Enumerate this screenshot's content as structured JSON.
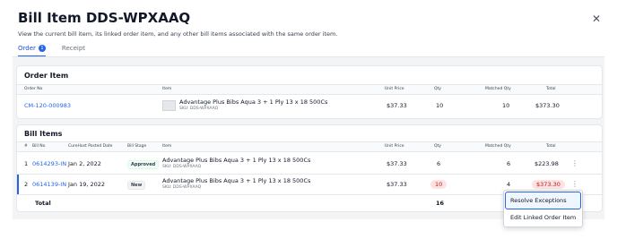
{
  "modal": {
    "title": "Bill Item DDS-WPXAAQ",
    "close_icon": "close-icon",
    "description": "View the current bill item, its linked order item, and any other bill items associated with the same order item."
  },
  "tabs": [
    {
      "label": "Order",
      "count": "1",
      "active": true
    },
    {
      "label": "Receipt",
      "active": false
    }
  ],
  "order_item": {
    "title": "Order Item",
    "columns": {
      "order_no": "Order No",
      "item": "Item",
      "unit_price": "Unit Price",
      "qty": "Qty",
      "matched_qty": "Matched Qty",
      "total": "Total"
    },
    "row": {
      "order_no": "CM-120-000983",
      "item_name": "Advantage Plus Bibs Aqua 3 + 1 Ply 13 x 18 500Cs",
      "sku": "SKU: DDS-WPXAAQ",
      "unit_price": "$37.33",
      "qty": "10",
      "matched_qty": "10",
      "total": "$373.30"
    }
  },
  "bill_items": {
    "title": "Bill Items",
    "columns": {
      "num": "#",
      "bill_no": "Bill No",
      "posted_date": "CureHost Posted Date",
      "bill_stage": "Bill Stage",
      "item": "Item",
      "unit_price": "Unit Price",
      "qty": "Qty",
      "matched_qty": "Matched Qty",
      "total": "Total"
    },
    "rows": [
      {
        "num": "1",
        "bill_no": "0614293-IN",
        "posted_date": "Jan 2, 2022",
        "stage": "Approved",
        "item_name": "Advantage Plus Bibs Aqua 3 + 1 Ply 13 x 18 500Cs",
        "sku": "SKU: DDS-WPXAAQ",
        "unit_price": "$37.33",
        "qty": "6",
        "matched_qty": "6",
        "total": "$223.98",
        "kebab": "⋮"
      },
      {
        "num": "2",
        "bill_no": "0614139-IN",
        "posted_date": "Jan 19, 2022",
        "stage": "New",
        "item_name": "Advantage Plus Bibs Aqua 3 + 1 Ply 13 x 18 500Cs",
        "sku": "SKU: DDS-WPXAAQ",
        "unit_price": "$37.33",
        "qty": "10",
        "matched_qty": "4",
        "total": "$373.30",
        "kebab": "⋮"
      }
    ],
    "footer": {
      "label": "Total",
      "qty": "16"
    }
  },
  "context_menu": {
    "items": [
      "Resolve Exceptions",
      "Edit Linked Order Item"
    ]
  },
  "colors": {
    "accent": "#2563eb",
    "danger_bg": "#fee2e2",
    "danger_text": "#b91c1c"
  }
}
